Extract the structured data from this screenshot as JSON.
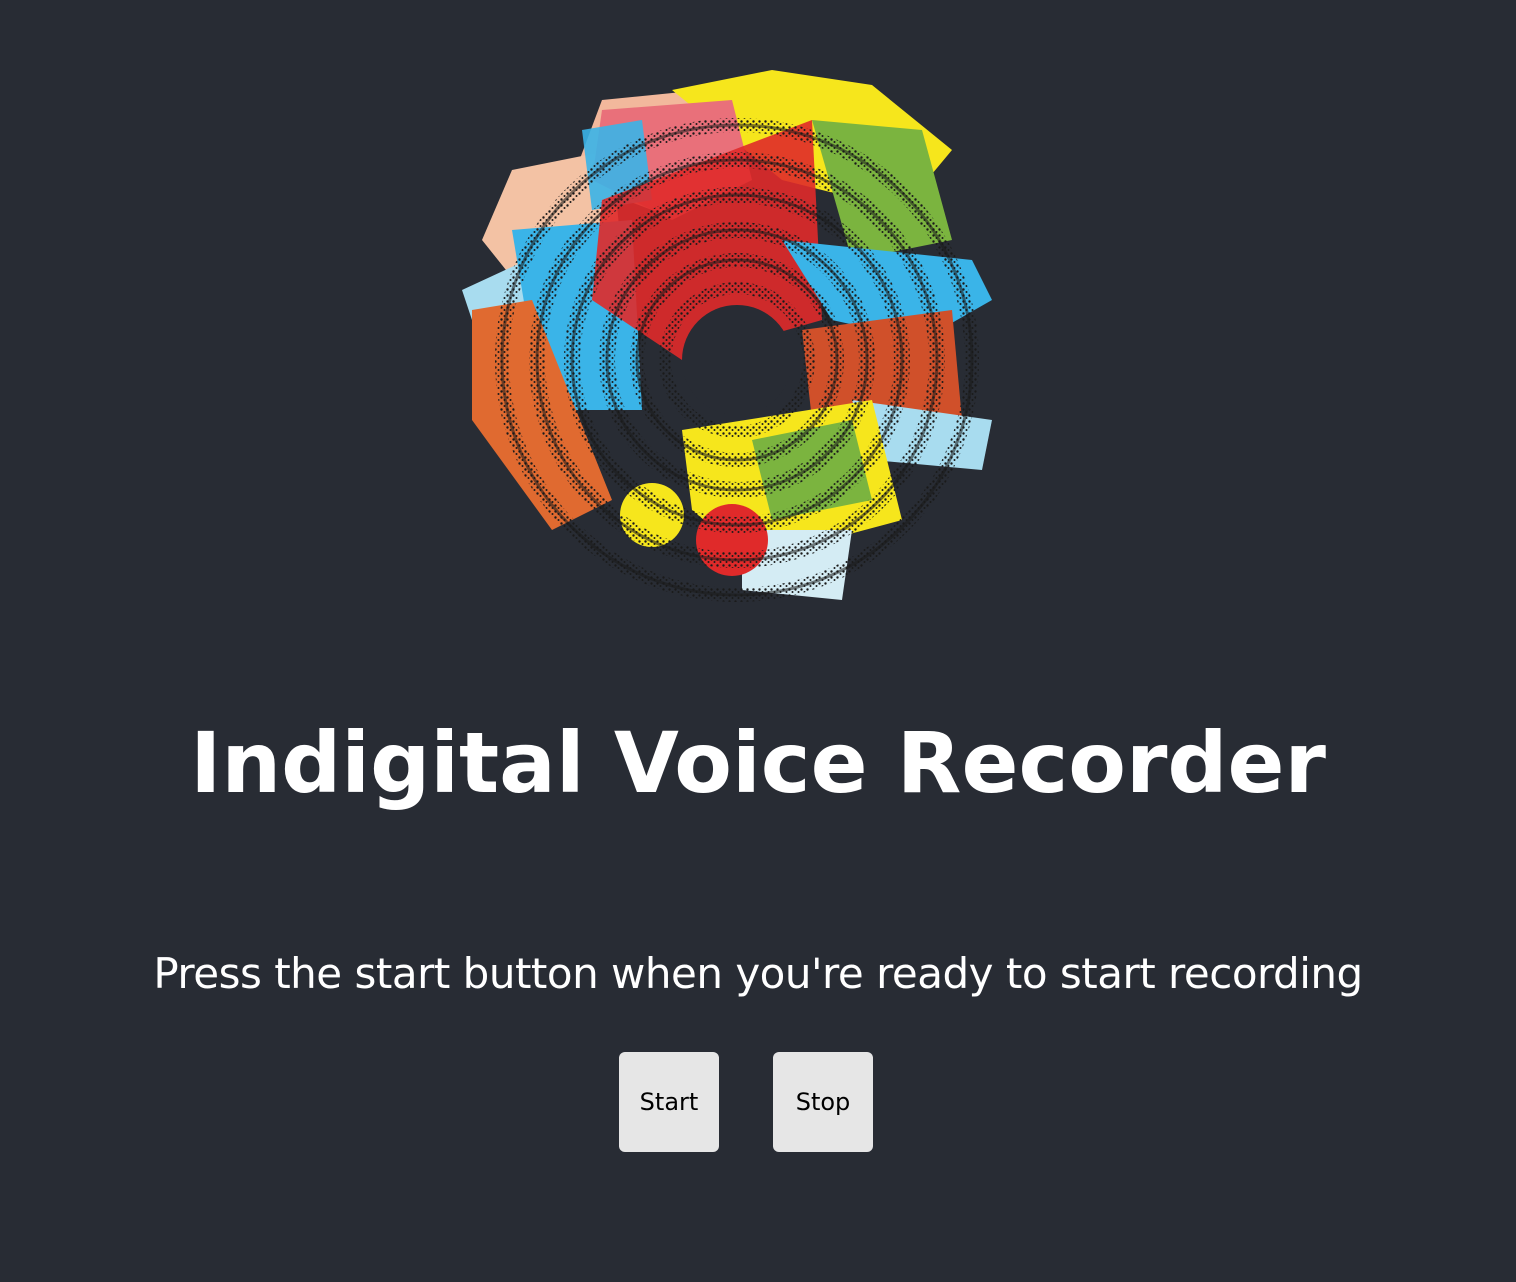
{
  "logo": {
    "icon": "spiral-sound-logo"
  },
  "heading": {
    "title": "Indigital Voice Recorder"
  },
  "instructions": {
    "text": "Press the start button when you're ready to start recording"
  },
  "controls": {
    "start_label": "Start",
    "stop_label": "Stop"
  },
  "colors": {
    "background": "#282c34",
    "text": "#ffffff",
    "button_bg": "#e6e6e6"
  }
}
